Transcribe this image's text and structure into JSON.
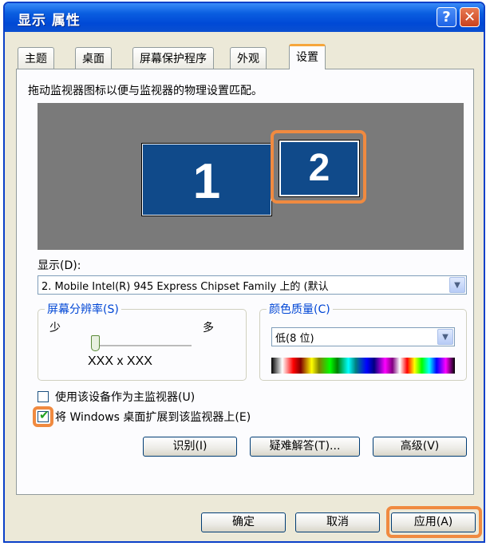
{
  "window": {
    "title": "显示 属性",
    "help_glyph": "?",
    "close_glyph": "✕"
  },
  "tabs": [
    {
      "label": "主题"
    },
    {
      "label": "桌面"
    },
    {
      "label": "屏幕保护程序"
    },
    {
      "label": "外观"
    },
    {
      "label": "设置",
      "active": true
    }
  ],
  "settings": {
    "instruction": "拖动监视器图标以便与监视器的物理设置匹配。",
    "monitors": [
      {
        "number": "1"
      },
      {
        "number": "2",
        "selected": true
      }
    ],
    "display_label": "显示(D):",
    "display_value": "2. Mobile Intel(R) 945 Express Chipset Family 上的 (默认",
    "resolution": {
      "label": "屏幕分辨率(S)",
      "less": "少",
      "more": "多",
      "value": "XXX x XXX"
    },
    "color_quality": {
      "label": "颜色质量(C)",
      "value": "低(8 位)"
    },
    "primary_checkbox": {
      "label": "使用该设备作为主监视器(U)",
      "checked": false
    },
    "extend_checkbox": {
      "label": "将 Windows 桌面扩展到该监视器上(E)",
      "checked": true
    },
    "buttons": {
      "identify": "识别(I)",
      "troubleshoot": "疑难解答(T)...",
      "advanced": "高级(V)"
    }
  },
  "footer": {
    "ok": "确定",
    "cancel": "取消",
    "apply": "应用(A)"
  },
  "colors": {
    "title_bar": "#0049d6",
    "highlight": "#f08a40",
    "monitor": "#104a8a",
    "desktop": "#7a7a7a"
  }
}
